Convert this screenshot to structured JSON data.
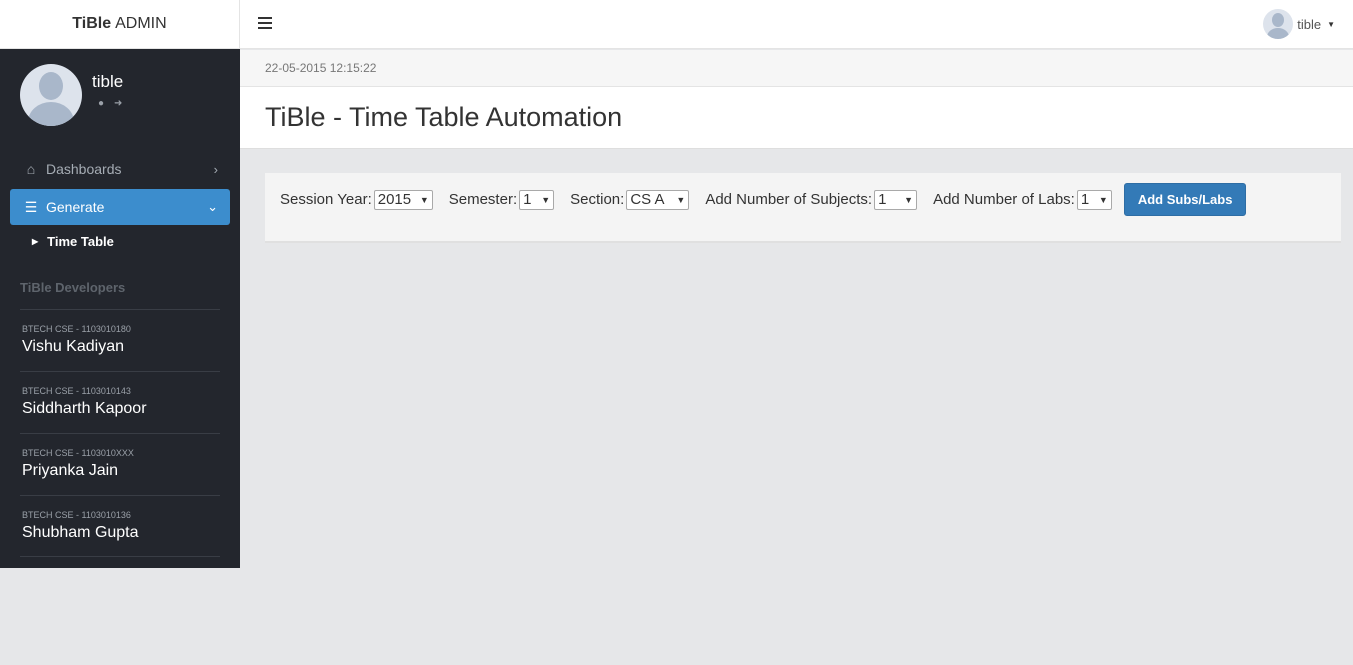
{
  "brand": {
    "bold": "TiBle",
    "light": "ADMIN"
  },
  "sidebar": {
    "user_name": "tible",
    "nav": [
      {
        "label": "Dashboards",
        "icon": "home-icon"
      },
      {
        "label": "Generate",
        "icon": "table-icon"
      }
    ],
    "subitem": "Time Table",
    "developers_title": "TiBle Developers",
    "developers": [
      {
        "sub": "BTECH CSE - 1103010180",
        "name": "Vishu Kadiyan"
      },
      {
        "sub": "BTECH CSE - 1103010143",
        "name": "Siddharth Kapoor"
      },
      {
        "sub": "BTECH CSE - 1103010XXX",
        "name": "Priyanka Jain"
      },
      {
        "sub": "BTECH CSE - 1103010136",
        "name": "Shubham Gupta"
      }
    ]
  },
  "topbar": {
    "user_name": "tible"
  },
  "datetime": "22-05-2015 12:15:22",
  "page_title": "TiBle - Time Table Automation",
  "form": {
    "session_year": {
      "label": "Session Year:",
      "value": "2015"
    },
    "semester": {
      "label": "Semester:",
      "value": "1"
    },
    "section": {
      "label": "Section:",
      "value": "CS A"
    },
    "subjects": {
      "label": "Add Number of Subjects:",
      "value": "1"
    },
    "labs": {
      "label": "Add Number of Labs:",
      "value": "1"
    },
    "submit_label": "Add Subs/Labs"
  },
  "colors": {
    "sidebar_bg": "#23262d",
    "accent": "#3c8dcd",
    "button": "#337ab7"
  }
}
